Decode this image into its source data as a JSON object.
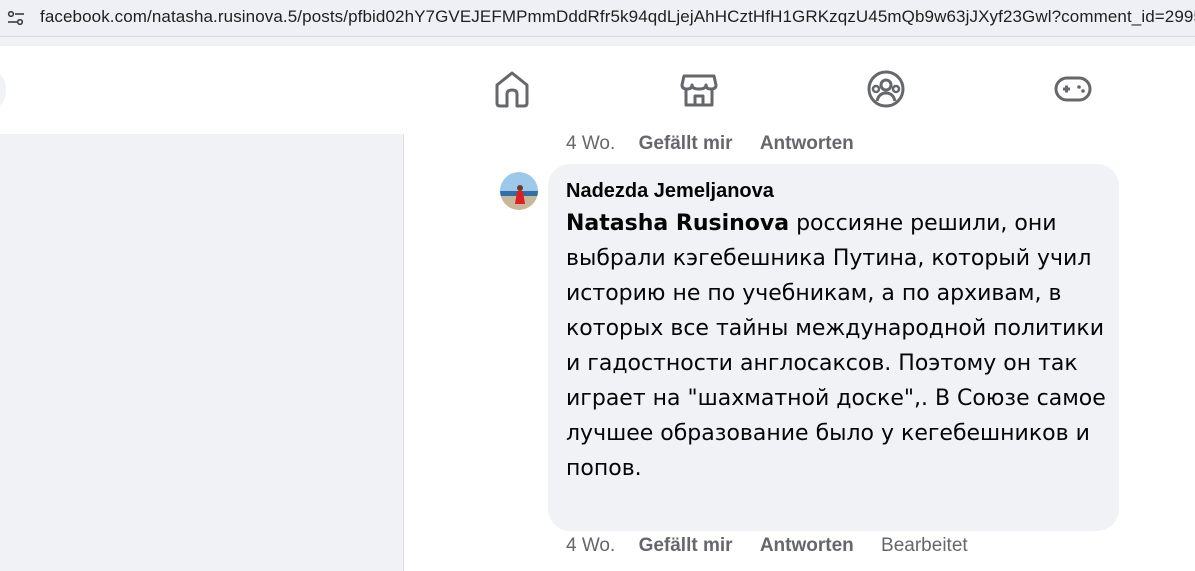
{
  "browser": {
    "url": "facebook.com/natasha.rusinova.5/posts/pfbid02hY7GVEJEFMPmmDddRfr5k94qdLjejAhHCztHfH1GRKzqzU45mQb9w63jJXyf23Gwl?comment_id=2995"
  },
  "nav": {
    "icons": [
      "home-icon",
      "marketplace-icon",
      "groups-icon",
      "gaming-icon"
    ]
  },
  "prev_comment": {
    "time": "4 Wo.",
    "like": "Gefällt mir",
    "reply": "Antworten"
  },
  "comment": {
    "author": "Nadezda Jemeljanova",
    "mention": "Natasha Rusinova",
    "text": " россияне решили, они выбрали кэгебешника Путина, который учил историю не по учебникам, а по архивам, в которых все тайны международной политики и гадостности англосаксов. Поэтому он так играет на \"шахматной доске\",. В Союзе самое лучшее образование было у кегебешников и попов.",
    "time": "4 Wo.",
    "like": "Gefällt mir",
    "reply": "Antworten",
    "edited": "Bearbeitet"
  }
}
